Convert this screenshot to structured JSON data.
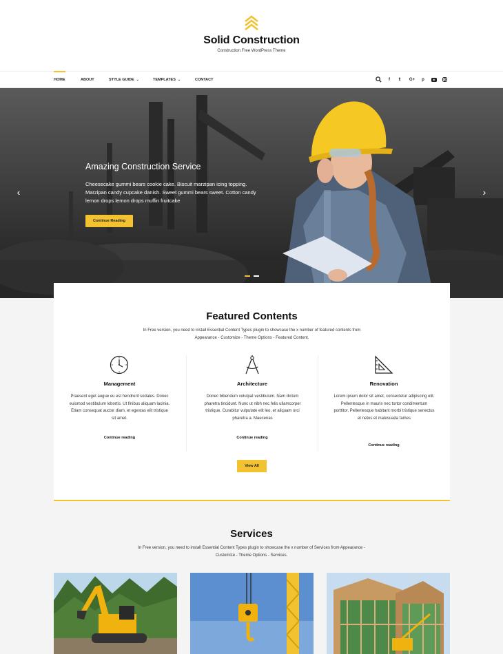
{
  "site": {
    "title": "Solid Construction",
    "tagline": "Construction Free WordPress Theme",
    "accent_color": "#f2c230"
  },
  "nav": {
    "items": [
      {
        "label": "HOME",
        "active": true
      },
      {
        "label": "ABOUT"
      },
      {
        "label": "STYLE GUIDE",
        "has_dropdown": true
      },
      {
        "label": "TEMPLATES",
        "has_dropdown": true
      },
      {
        "label": "CONTACT"
      }
    ],
    "icons": [
      "search-icon",
      "facebook-icon",
      "twitter-icon",
      "google-plus-icon",
      "pinterest-icon",
      "youtube-icon",
      "instagram-icon"
    ]
  },
  "hero": {
    "title": "Amazing Construction Service",
    "text": "Cheesecake gummi bears cookie cake. Biscuit marzipan icing topping. Marzipan candy cupcake danish. Sweet gummi bears sweet. Cotton candy lemon drops lemon drops muffin fruitcake",
    "button_label": "Continue Reading",
    "slide_count": 2,
    "active_slide": 1
  },
  "featured": {
    "title": "Featured Contents",
    "description_line1": "In Free version, you need to install Essential Content Types plugin to showcase the x number of featured contents from",
    "description_line2": "Appearance - Customize - Theme Options - Featured Content.",
    "items": [
      {
        "title": "Management",
        "icon": "clock-icon",
        "text": "Praesent eget augue eu est hendrerit sodales. Donec euismod vestibulum lobortis. Ut finibus aliquam lacinia. Etiam consequat auctor diam, et egestas elit tristique sit amet.",
        "link": "Continue reading"
      },
      {
        "title": "Architecture",
        "icon": "compass-icon",
        "text": "Donec bibendum volutpat vestibulum. Nam dictum pharetra tincidunt. Nunc ut nibh nec felis ullamcorper tristique. Curabitur vulputate elit leo, et aliquam orci pharetra a. Maecenas",
        "link": "Continue reading"
      },
      {
        "title": "Renovation",
        "icon": "set-square-icon",
        "text": "Lorem ipsum dolor sit amet, consectetur adipiscing elit. Pellentesque in mauris nec tortor condimentum porttitor. Pellentesque habitant morbi tristique senectus et netus et malesuada fames",
        "link": "Continue reading"
      }
    ],
    "view_all_label": "View All"
  },
  "services": {
    "title": "Services",
    "description_line1": "In Free version, you need to install Essential Content Types plugin to showcase the x number of Services from Appearance -",
    "description_line2": "Customize - Theme Options - Services."
  }
}
